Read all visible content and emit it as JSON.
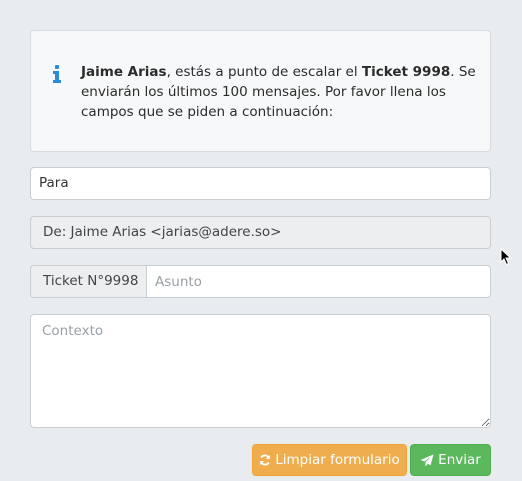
{
  "info": {
    "user_name": "Jaime Arias",
    "text_1": ", estás a punto de escalar el ",
    "ticket_label": "Ticket 9998",
    "text_2": ". Se enviarán los últimos 100 mensajes. Por favor llena los campos que se piden a continuación:",
    "icon": "info-icon"
  },
  "form": {
    "to_value": "Para",
    "from_value": "De: Jaime Arias <jarias@adere.so>",
    "ticket_addon": "Ticket N°9998",
    "subject_placeholder": "Asunto",
    "context_placeholder": "Contexto"
  },
  "buttons": {
    "clear_label": "Limpiar formulario",
    "clear_icon": "refresh-icon",
    "send_label": "Enviar",
    "send_icon": "paper-plane-icon"
  },
  "colors": {
    "clear": "#f0ad4e",
    "send": "#5cb85c",
    "info_icon": "#2a8bd8"
  }
}
